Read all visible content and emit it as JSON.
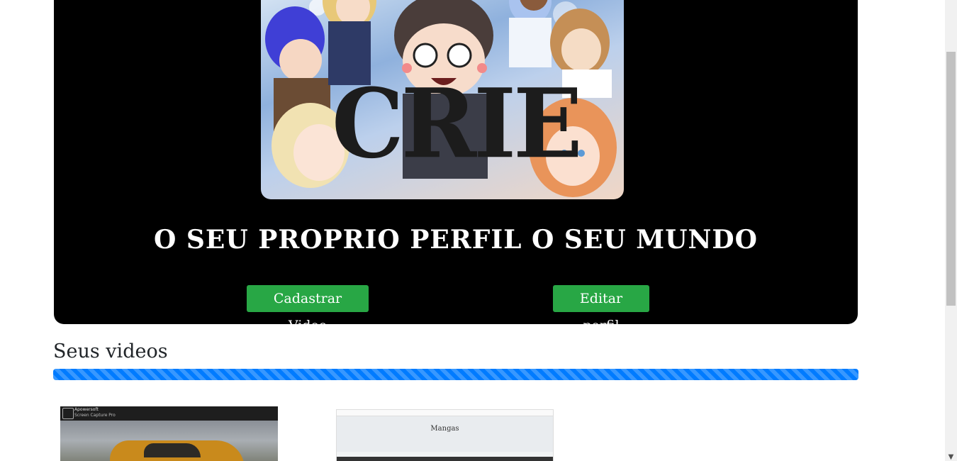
{
  "hero": {
    "banner_text": "CRIE",
    "tagline": "O SEU PROPRIO PERFIL O SEU MUNDO",
    "buttons": {
      "register_video": "Cadastrar Video",
      "edit_profile": "Editar perfil"
    }
  },
  "videos_section": {
    "title": "Seus videos",
    "progress_percent": 100,
    "thumbnails": [
      {
        "app_title": "Apowersoft",
        "app_subtitle": "Screen Capture Pro"
      },
      {
        "title": "Mangas"
      }
    ]
  },
  "colors": {
    "hero_bg": "#000000",
    "button_green": "#28a745",
    "progress_blue": "#007bff"
  },
  "icons": {
    "scroll_down": "chevron-down-icon"
  }
}
